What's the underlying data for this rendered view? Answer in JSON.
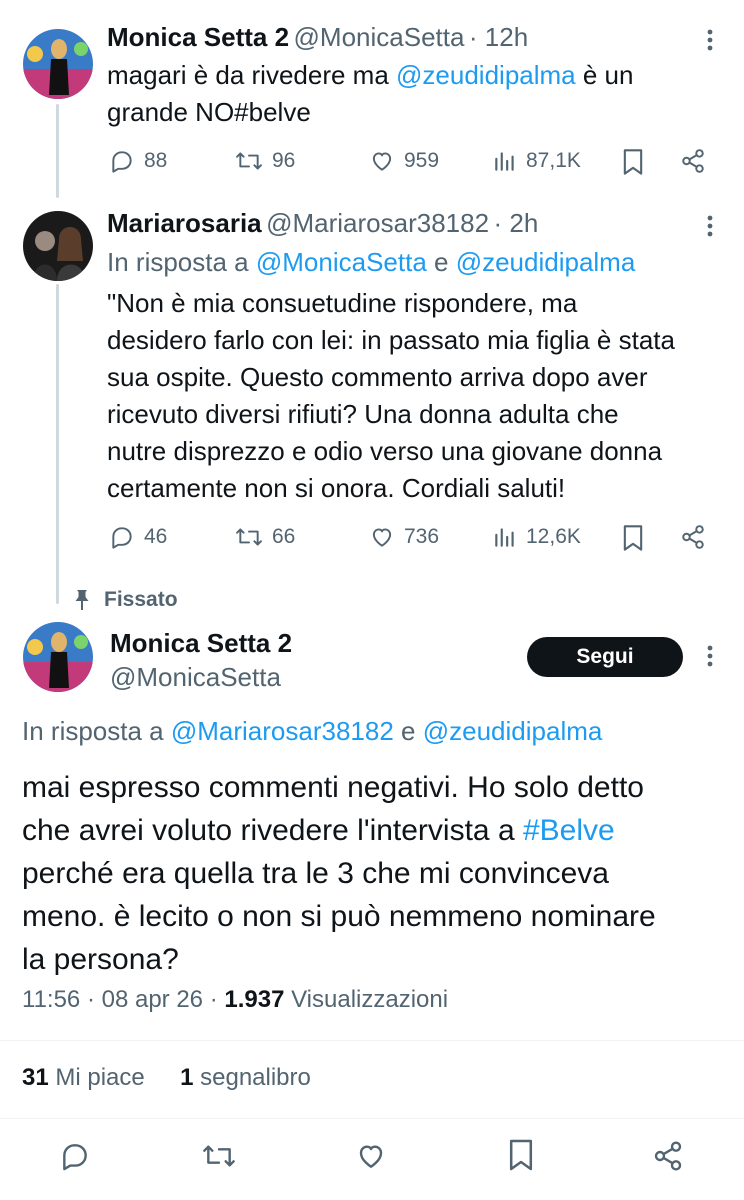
{
  "tweet1": {
    "name": "Monica Setta 2",
    "handle": "@MonicaSetta",
    "time": "· 12h",
    "text_pre": "magari è da rivedere ma ",
    "mention": "@zeudidipalma",
    "text_post_line1": " è un",
    "text_line2": "grande NO#belve",
    "replies": "88",
    "retweets": "96",
    "likes": "959",
    "views": "87,1K"
  },
  "tweet2": {
    "name": "Mariarosaria",
    "handle": "@Mariarosar38182",
    "time": "· 2h",
    "reply_prefix": "In risposta a ",
    "reply_mention1": "@MonicaSetta",
    "reply_and": " e ",
    "reply_mention2": "@zeudidipalma",
    "lines": [
      "\"Non è mia consuetudine rispondere, ma",
      "desidero farlo con lei: in passato mia figlia è stata",
      "sua ospite. Questo commento arriva dopo aver",
      "ricevuto diversi rifiuti? Una donna adulta che",
      "nutre disprezzo e odio verso una giovane donna",
      "certamente non si onora. Cordiali saluti!"
    ],
    "replies": "46",
    "retweets": "66",
    "likes": "736",
    "views": "12,6K"
  },
  "pinned": {
    "label": "Fissato"
  },
  "main": {
    "name": "Monica Setta 2",
    "handle": "@MonicaSetta",
    "follow_label": "Segui",
    "reply_prefix": "In risposta a ",
    "reply_mention1": "@Mariarosar38182",
    "reply_and": " e ",
    "reply_mention2": "@zeudidipalma",
    "line1": "mai espresso commenti negativi. Ho solo detto",
    "line2_pre": "che avrei voluto rivedere l'intervista a ",
    "line2_tag": "#Belve",
    "line3": "perché era quella tra le 3 che mi convinceva",
    "line4": "meno. è lecito o non si può nemmeno nominare",
    "line5": "la persona?",
    "time": "11:56 · 08 apr 26 · ",
    "views_count": "1.937",
    "views_label": " Visualizzazioni",
    "likes_count": "31",
    "likes_label": " Mi piace",
    "bookmarks_count": "1",
    "bookmarks_label": " segnalibro"
  },
  "colors": {
    "accent": "#1d9bf0",
    "text": "#0f1419",
    "muted": "#536471"
  }
}
